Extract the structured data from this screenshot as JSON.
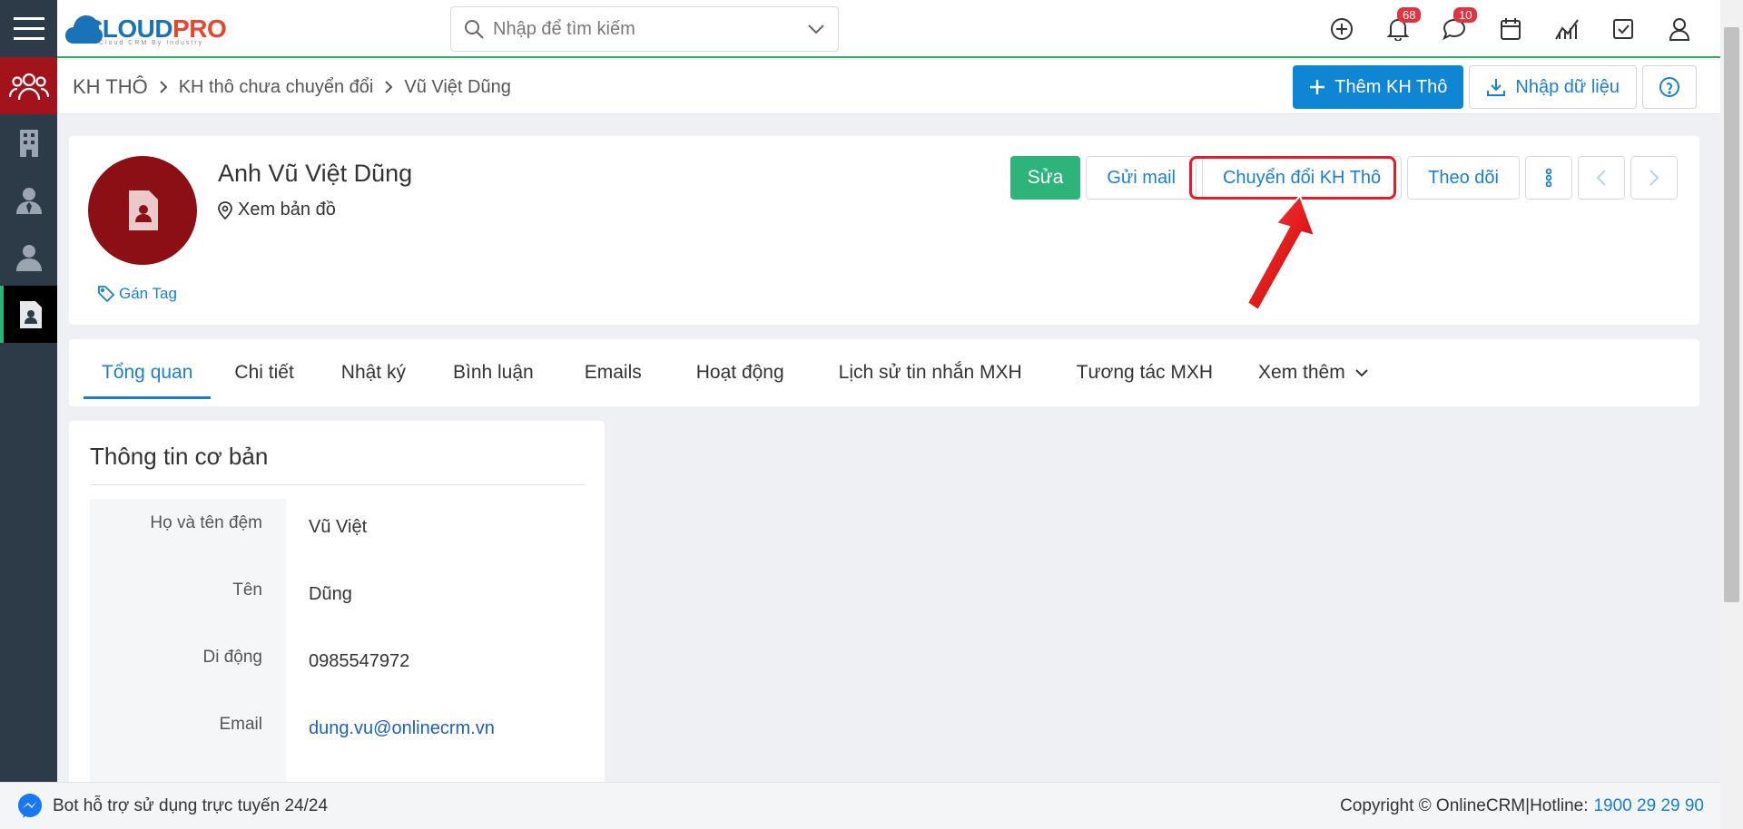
{
  "app": {
    "logo_main": "CLOUD",
    "logo_accent": "PRO",
    "logo_tagline": "Cloud CRM By Industry"
  },
  "rail": {
    "items": [
      {
        "icon": "users-icon"
      },
      {
        "icon": "building-icon"
      },
      {
        "icon": "contacts-icon"
      },
      {
        "icon": "person-icon"
      },
      {
        "icon": "contact-card-icon"
      }
    ]
  },
  "search": {
    "placeholder": "Nhập để tìm kiếm"
  },
  "top_icons": {
    "notifications_count": "68",
    "messages_count": "10"
  },
  "breadcrumb": {
    "root": "KH THÔ",
    "level1": "KH thô chưa chuyển đổi",
    "level2": "Vũ Việt Dũng"
  },
  "header_actions": {
    "add_label": "Thêm KH Thô",
    "import_label": "Nhập dữ liệu"
  },
  "profile": {
    "name": "Anh Vũ Việt Dũng",
    "map_label": "Xem bản đồ",
    "tag_label": "Gán Tag",
    "actions": {
      "edit": "Sửa",
      "send_mail": "Gửi mail",
      "convert": "Chuyển đổi KH Thô",
      "follow": "Theo dõi"
    }
  },
  "tabs": [
    {
      "label": "Tổng quan"
    },
    {
      "label": "Chi tiết"
    },
    {
      "label": "Nhật ký"
    },
    {
      "label": "Bình luận"
    },
    {
      "label": "Emails"
    },
    {
      "label": "Hoạt động"
    },
    {
      "label": "Lịch sử tin nhắn MXH"
    },
    {
      "label": "Tương tác MXH"
    },
    {
      "label": "Xem thêm"
    }
  ],
  "basic_info": {
    "title": "Thông tin cơ bản",
    "rows": [
      {
        "label": "Họ và tên đệm",
        "value": "Vũ Việt"
      },
      {
        "label": "Tên",
        "value": "Dũng"
      },
      {
        "label": "Di động",
        "value": "0985547972"
      },
      {
        "label": "Email",
        "value": "dung.vu@onlinecrm.vn"
      }
    ]
  },
  "footer": {
    "bot_text": "Bot hỗ trợ sử dụng trực tuyến 24/24",
    "copyright": "Copyright © OnlineCRM|Hotline:",
    "hotline": "1900 29 29 90"
  },
  "colors": {
    "brand_blue": "#0e86d4",
    "brand_green": "#2eb37b",
    "rail_bg": "#2d3a47",
    "rail_active_red": "#a3131b",
    "avatar_bg": "#8b0f14",
    "highlight_red": "#e11d2b"
  }
}
